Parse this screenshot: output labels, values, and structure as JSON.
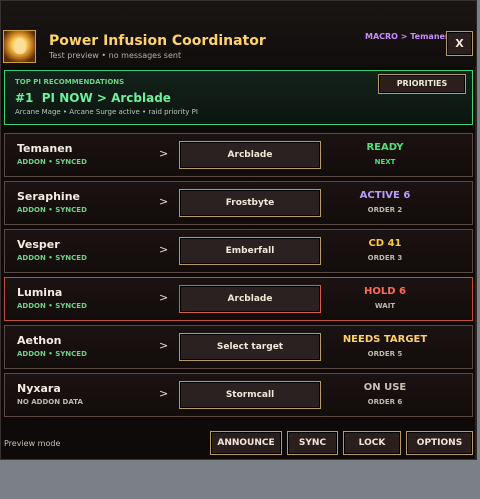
{
  "header": {
    "title": "Power Infusion Coordinator",
    "subtitle": "Test preview • no messages sent",
    "macro": "MACRO > Temanen",
    "close_label": "X"
  },
  "recommendation": {
    "label": "TOP PI RECOMMENDATIONS",
    "rank": "#1",
    "main": "PI NOW > Arcblade",
    "detail": "Arcane Mage • Arcane Surge active • raid priority PI",
    "priorities_label": "PRIORITIES"
  },
  "rows": [
    {
      "name": "Temanen",
      "addon": "ADDON • SYNCED",
      "target": "Arcblade",
      "status": "READY",
      "status_color": "#4fe07a",
      "sub": "NEXT",
      "sub_color": "#4fe07a"
    },
    {
      "name": "Seraphine",
      "addon": "ADDON • SYNCED",
      "target": "Frostbyte",
      "status": "ACTIVE 6",
      "status_color": "#b89cff",
      "sub": "ORDER 2",
      "sub_color": "#c0b8ac"
    },
    {
      "name": "Vesper",
      "addon": "ADDON • SYNCED",
      "target": "Emberfall",
      "status": "CD 41",
      "status_color": "#ffc640",
      "sub": "ORDER 3",
      "sub_color": "#c0b8ac"
    },
    {
      "name": "Lumina",
      "addon": "ADDON • SYNCED",
      "target": "Arcblade",
      "status": "HOLD 6",
      "status_color": "#ff6a52",
      "sub": "WAIT",
      "sub_color": "#c0b8ac"
    },
    {
      "name": "Aethon",
      "addon": "ADDON • SYNCED",
      "target": "Select target",
      "status": "NEEDS TARGET",
      "status_color": "#ffcf6a",
      "sub": "ORDER 5",
      "sub_color": "#c0b8ac"
    },
    {
      "name": "Nyxara",
      "addon": "NO ADDON DATA",
      "target": "Stormcall",
      "status": "ON USE",
      "status_color": "#c8c0b4",
      "sub": "ORDER 6",
      "sub_color": "#c0b8ac"
    }
  ],
  "arrow": ">",
  "footer": {
    "mode": "Preview mode",
    "announce": "ANNOUNCE",
    "sync": "SYNC",
    "lock": "LOCK",
    "options": "OPTIONS"
  }
}
